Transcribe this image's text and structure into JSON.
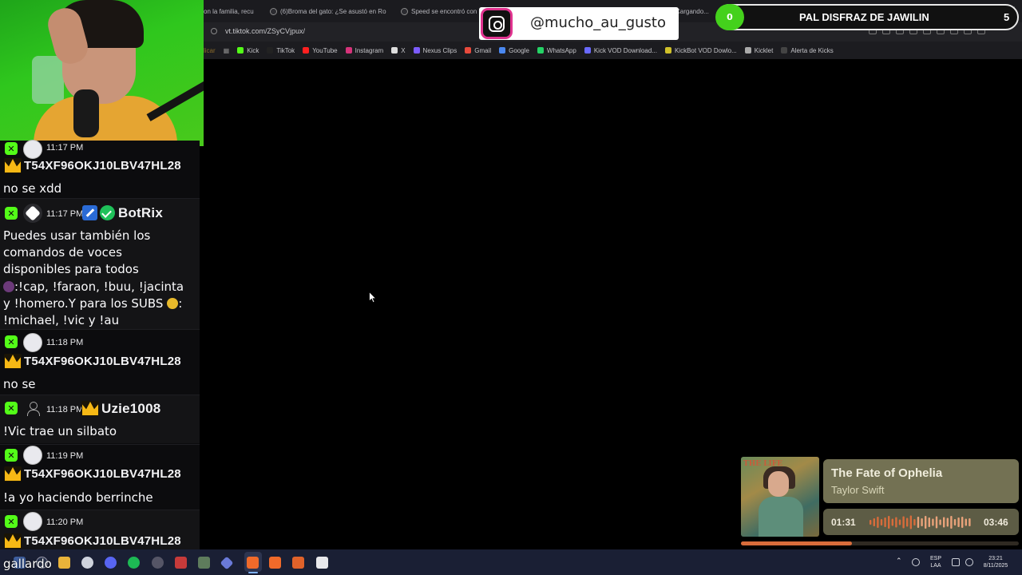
{
  "browser": {
    "tabs": [
      {
        "title": "on la familia, recu"
      },
      {
        "title": "(6)Broma del gato: ¿Se asustó en Ro"
      },
      {
        "title": "Speed se encontró con"
      },
      {
        "title": "Cargando..."
      }
    ],
    "url": "vt.tiktok.com/ZSyCVjpux/",
    "bookmarks": [
      {
        "label": "licar",
        "color": "#8a6a2a"
      },
      {
        "label": "Kick",
        "color": "#53fc18"
      },
      {
        "label": "TikTok",
        "color": "#222222"
      },
      {
        "label": "YouTube",
        "color": "#ff2020"
      },
      {
        "label": "Instagram",
        "color": "#d6337a"
      },
      {
        "label": "X",
        "color": "#dddddd"
      },
      {
        "label": "Nexus Clips",
        "color": "#7c5cff"
      },
      {
        "label": "Gmail",
        "color": "#e84a3c"
      },
      {
        "label": "Google",
        "color": "#4a88f0"
      },
      {
        "label": "WhatsApp",
        "color": "#25d366"
      },
      {
        "label": "Kick VOD Download...",
        "color": "#6a6aff"
      },
      {
        "label": "KickBot VOD Dowlo...",
        "color": "#d0c12a"
      },
      {
        "label": "Kicklet",
        "color": "#aaaaaa"
      },
      {
        "label": "Alerta de Kicks",
        "color": "#444444"
      }
    ]
  },
  "instagram_overlay": {
    "handle": "@mucho_au_gusto"
  },
  "goal_overlay": {
    "current": "0",
    "title": "PAL DISFRAZ DE JAWILIN",
    "target": "5",
    "accent": "#44d11c"
  },
  "chat": {
    "messages": [
      {
        "time": "11:17 PM",
        "username": "T54XF96OKJ10LBV47HL28",
        "text": "no se xdd"
      },
      {
        "time": "11:17 PM",
        "username": "BotRix",
        "text_lines": [
          "Puedes usar también los",
          "comandos de voces",
          "disponibles para todos",
          ":!cap, !faraon, !buu, !jacinta",
          "y !homero.Y para los SUBS",
          ":",
          "!michael, !vic y !au"
        ]
      },
      {
        "time": "11:18 PM",
        "username": "T54XF96OKJ10LBV47HL28",
        "text": "no se"
      },
      {
        "time": "11:18 PM",
        "username": "Uzie1008",
        "text": "!Vic trae un silbato"
      },
      {
        "time": "11:19 PM",
        "username": "T54XF96OKJ10LBV47HL28",
        "text": "!a yo haciendo berrinche"
      },
      {
        "time": "11:20 PM",
        "username": "T54XF96OKJ10LBV47HL28",
        "text": ""
      }
    ],
    "kick_badge_color": "#53fc18"
  },
  "now_playing": {
    "title": "The Fate of Ophelia",
    "artist": "Taylor Swift",
    "elapsed": "01:31",
    "duration": "03:46",
    "progress": 0.4,
    "album_text": "THE LIFE",
    "accent": "#d86c3b"
  },
  "overlay_name": "gallardo",
  "taskbar": {
    "lang_line1": "ESP",
    "lang_line2": "LAA",
    "time": "23:21",
    "date": "8/11/2025"
  }
}
